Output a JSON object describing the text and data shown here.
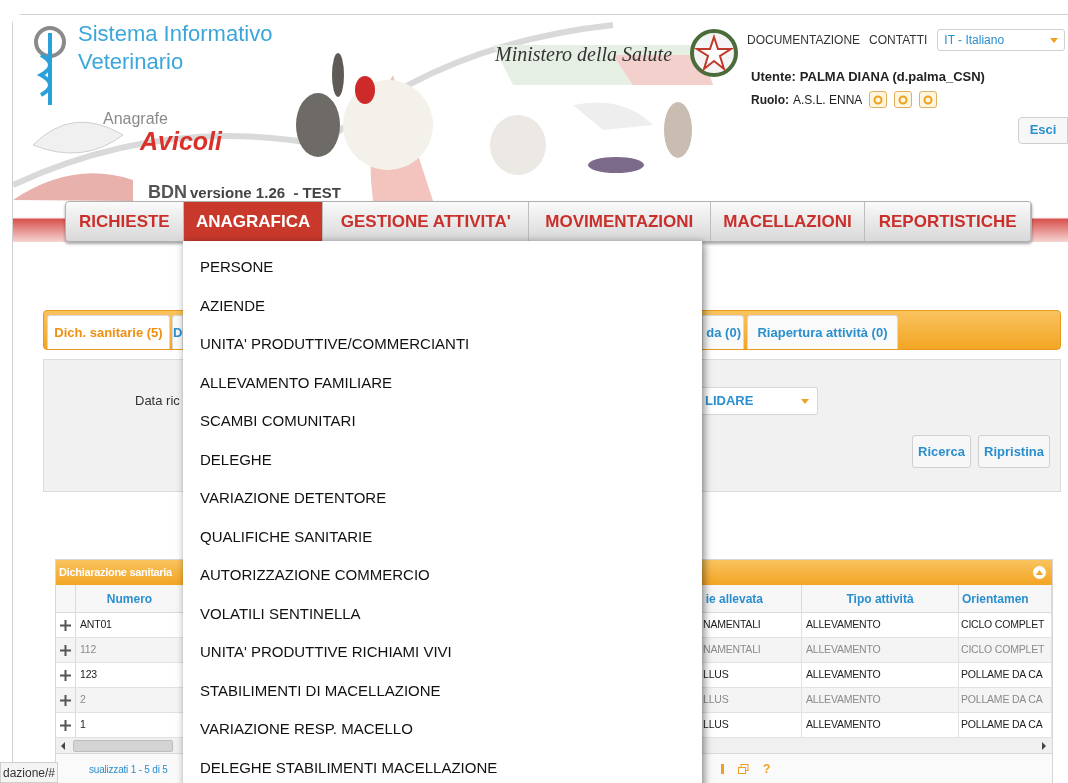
{
  "header": {
    "title_line_1": "Sistema Informativo",
    "title_line_2": "Veterinario",
    "subtitle": "Anagrafe",
    "app_name": "Avicoli",
    "bdn": "BDN",
    "version": "versione 1.26  - TEST",
    "ministry": "Ministero della Salute",
    "links": [
      "DOCUMENTAZIONE",
      "CONTATTI"
    ],
    "language": "IT - Italiano",
    "user_label": "Utente:",
    "user": "PALMA DIANA (d.palma_CSN)",
    "role_label": "Ruolo:",
    "role": "A.S.L. ENNA",
    "logout": "Esci"
  },
  "menu": [
    {
      "label": "RICHIESTE",
      "selected": false
    },
    {
      "label": "ANAGRAFICA",
      "selected": true
    },
    {
      "label": "GESTIONE ATTIVITA'",
      "selected": false
    },
    {
      "label": "MOVIMENTAZIONI",
      "selected": false
    },
    {
      "label": "MACELLAZIONI",
      "selected": false
    },
    {
      "label": "REPORTISTICHE",
      "selected": false
    }
  ],
  "dropdown": [
    "PERSONE",
    "AZIENDE",
    "UNITA' PRODUTTIVE/COMMERCIANTI",
    "ALLEVAMENTO FAMILIARE",
    "SCAMBI COMUNITARI",
    "DELEGHE",
    "VARIAZIONE DETENTORE",
    "QUALIFICHE SANITARIE",
    "AUTORIZZAZIONE COMMERCIO",
    "VOLATILI SENTINELLA",
    "UNITA' PRODUTTIVE RICHIAMI VIVI",
    "STABILIMENTI DI MACELLAZIONE",
    "VARIAZIONE RESP. MACELLO",
    "DELEGHE STABILIMENTI MACELLAZIONE"
  ],
  "tabs": [
    {
      "label": "Dich. sanitarie (5)",
      "selected": true
    },
    {
      "label": "D",
      "selected": false
    },
    {
      "label": "da (0)",
      "selected": false
    },
    {
      "label": "Riapertura attività (0)",
      "selected": false
    }
  ],
  "filter": {
    "label": "Data ric",
    "select_value": "LIDARE",
    "buttons": [
      "Ricerca",
      "Ripristina"
    ]
  },
  "grid": {
    "title": "Dichiarazione sanitaria",
    "columns": [
      "Numero",
      "ie allevata",
      "Tipo attività",
      "Orientamen"
    ],
    "rows": [
      {
        "cells": [
          "ANT01",
          "NAMENTALI",
          "ALLEVAMENTO",
          "CICLO COMPLET"
        ],
        "dimmed": false
      },
      {
        "cells": [
          "112",
          "NAMENTALI",
          "ALLEVAMENTO",
          "CICLO COMPLET"
        ],
        "dimmed": true
      },
      {
        "cells": [
          "123",
          "LLUS",
          "ALLEVAMENTO",
          "POLLAME DA CA"
        ],
        "dimmed": false
      },
      {
        "cells": [
          "2",
          "LLUS",
          "ALLEVAMENTO",
          "POLLAME DA CA"
        ],
        "dimmed": true
      },
      {
        "cells": [
          "1",
          "LLUS",
          "ALLEVAMENTO",
          "POLLAME DA CA"
        ],
        "dimmed": false
      }
    ],
    "footer": "sualizzati 1 - 5 di 5",
    "help": "?"
  },
  "status_url": "dazione/#"
}
